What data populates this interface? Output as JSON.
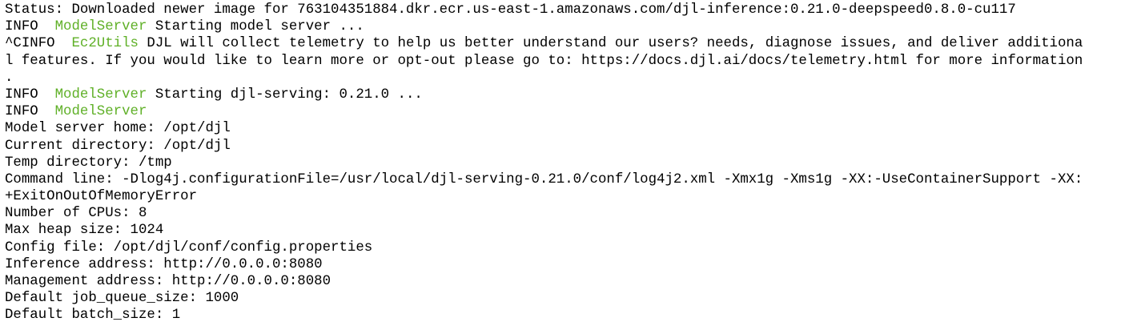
{
  "terminal": {
    "colors": {
      "background": "#ffffff",
      "text": "#000000",
      "logger": "#5fb027"
    },
    "lines": [
      {
        "segments": [
          {
            "text": "Status: Downloaded newer image for 763104351884.dkr.ecr.us-east-1.amazonaws.com/djl-inference:0.21.0-deepspeed0.8.0-cu117",
            "style": "plain"
          }
        ]
      },
      {
        "segments": [
          {
            "text": "INFO  ",
            "style": "level"
          },
          {
            "text": "ModelServer",
            "style": "logger"
          },
          {
            "text": " Starting model server ...",
            "style": "plain"
          }
        ]
      },
      {
        "segments": [
          {
            "text": "^CINFO  ",
            "style": "level"
          },
          {
            "text": "Ec2Utils",
            "style": "logger"
          },
          {
            "text": " DJL will collect telemetry to help us better understand our users? needs, diagnose issues, and deliver additiona",
            "style": "plain"
          }
        ]
      },
      {
        "segments": [
          {
            "text": "l features. If you would like to learn more or opt-out please go to: https://docs.djl.ai/docs/telemetry.html for more information",
            "style": "plain"
          }
        ]
      },
      {
        "segments": [
          {
            "text": ".",
            "style": "plain"
          }
        ]
      },
      {
        "segments": [
          {
            "text": "INFO  ",
            "style": "level"
          },
          {
            "text": "ModelServer",
            "style": "logger"
          },
          {
            "text": " Starting djl-serving: 0.21.0 ...",
            "style": "plain"
          }
        ]
      },
      {
        "segments": [
          {
            "text": "INFO  ",
            "style": "level"
          },
          {
            "text": "ModelServer",
            "style": "logger"
          }
        ]
      },
      {
        "segments": [
          {
            "text": "Model server home: /opt/djl",
            "style": "plain"
          }
        ]
      },
      {
        "segments": [
          {
            "text": "Current directory: /opt/djl",
            "style": "plain"
          }
        ]
      },
      {
        "segments": [
          {
            "text": "Temp directory: /tmp",
            "style": "plain"
          }
        ]
      },
      {
        "segments": [
          {
            "text": "Command line: -Dlog4j.configurationFile=/usr/local/djl-serving-0.21.0/conf/log4j2.xml -Xmx1g -Xms1g -XX:-UseContainerSupport -XX:",
            "style": "plain"
          }
        ]
      },
      {
        "segments": [
          {
            "text": "+ExitOnOutOfMemoryError",
            "style": "plain"
          }
        ]
      },
      {
        "segments": [
          {
            "text": "Number of CPUs: 8",
            "style": "plain"
          }
        ]
      },
      {
        "segments": [
          {
            "text": "Max heap size: 1024",
            "style": "plain"
          }
        ]
      },
      {
        "segments": [
          {
            "text": "Config file: /opt/djl/conf/config.properties",
            "style": "plain"
          }
        ]
      },
      {
        "segments": [
          {
            "text": "Inference address: http://0.0.0.0:8080",
            "style": "plain"
          }
        ]
      },
      {
        "segments": [
          {
            "text": "Management address: http://0.0.0.0:8080",
            "style": "plain"
          }
        ]
      },
      {
        "segments": [
          {
            "text": "Default job_queue_size: 1000",
            "style": "plain"
          }
        ]
      },
      {
        "segments": [
          {
            "text": "Default batch_size: 1",
            "style": "plain"
          }
        ]
      }
    ]
  }
}
